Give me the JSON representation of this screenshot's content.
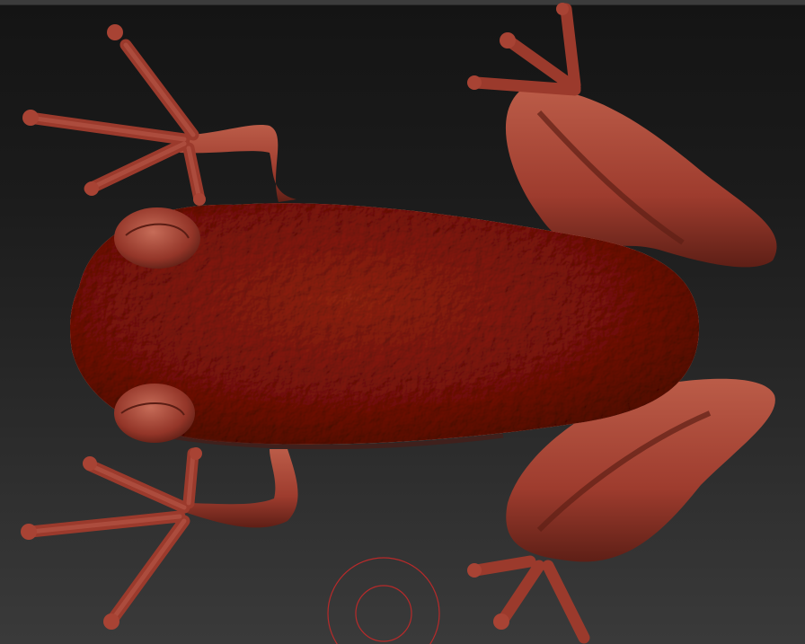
{
  "viewport": {
    "background_top": "#141414",
    "background_bottom": "#3a3a3a"
  },
  "model": {
    "subject": "frog-sculpt",
    "material_color": "#a84334",
    "material_shadow": "#5e1f16",
    "material_highlight": "#c9705d"
  },
  "brush_cursor": {
    "icon": "brush-ring-icon",
    "color": "#b82a2a"
  }
}
